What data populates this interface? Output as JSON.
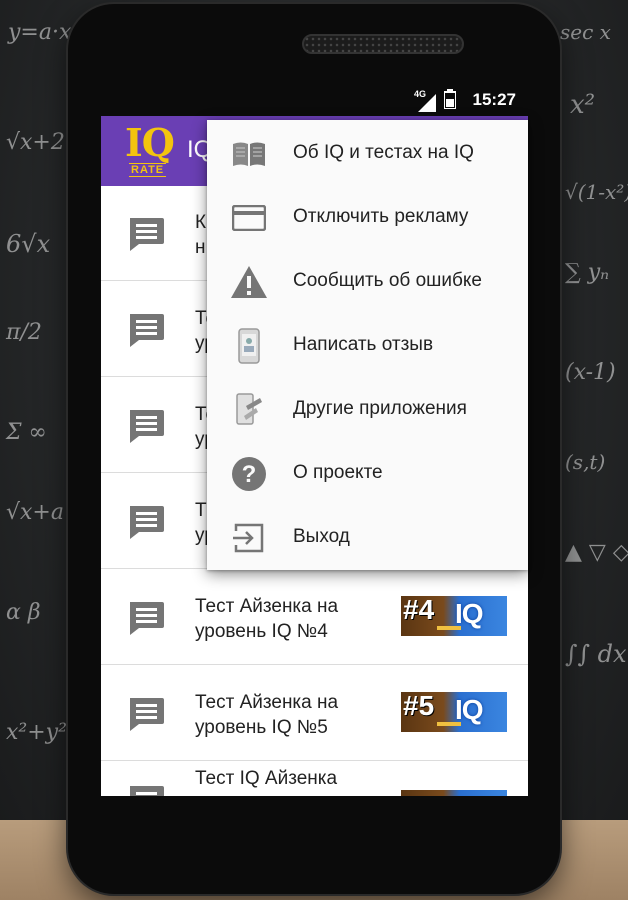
{
  "status_bar": {
    "time": "15:27",
    "network": "4G"
  },
  "app": {
    "title": "IQ",
    "logo_text": "IQ",
    "logo_subtext": "RATE",
    "accent_color": "#6a3fb4",
    "logo_color": "#f3c40f"
  },
  "list": {
    "items": [
      {
        "title": "К\nн",
        "thumb": ""
      },
      {
        "title": "Те\nуров",
        "thumb": ""
      },
      {
        "title": "Те\nур",
        "thumb": ""
      },
      {
        "title": "Т\nур",
        "thumb": ""
      },
      {
        "title": "Тест Айзенка на\nуровень IQ №4",
        "thumb": "#4"
      },
      {
        "title": "Тест Айзенка на\nуровень IQ №5",
        "thumb": "#5"
      },
      {
        "title": "Тест IQ Айзенка",
        "thumb": ""
      }
    ],
    "thumb_iq": "IQ"
  },
  "menu": {
    "items": [
      {
        "label": "Об IQ и тестах на IQ",
        "icon": "book-icon"
      },
      {
        "label": "Отключить рекламу",
        "icon": "card-icon"
      },
      {
        "label": "Сообщить об ошибке",
        "icon": "warning-icon"
      },
      {
        "label": "Написать отзыв",
        "icon": "phone-review-icon"
      },
      {
        "label": "Другие приложения",
        "icon": "apps-icon"
      },
      {
        "label": "О проекте",
        "icon": "help-icon"
      },
      {
        "label": "Выход",
        "icon": "exit-icon"
      }
    ]
  }
}
